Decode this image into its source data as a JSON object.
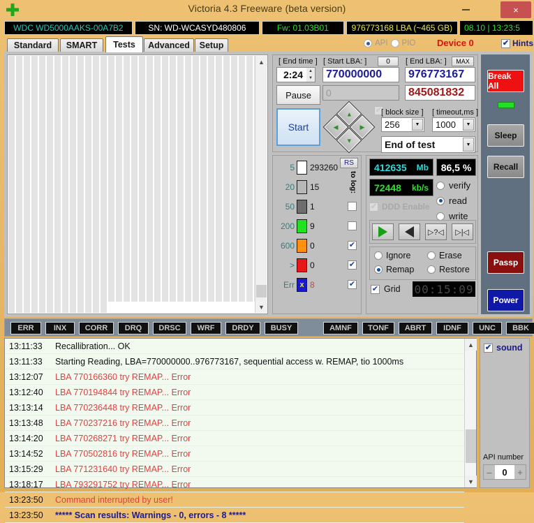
{
  "window": {
    "title": "Victoria 4.3 Freeware (beta version)",
    "icon": "green-cross-icon",
    "minimize": "–",
    "maximize": "□",
    "close": "×"
  },
  "drive_info": {
    "model": "WDC WD5000AAKS-00A7B2",
    "serial": "SN: WD-WCASYD480806",
    "firmware": "Fw: 01.03B01",
    "capacity": "976773168 LBA (~465 GB)",
    "clock": "08.10  |  13:23:5"
  },
  "tabs": [
    {
      "label": "Standard",
      "active": false
    },
    {
      "label": "SMART",
      "active": false
    },
    {
      "label": "Tests",
      "active": true
    },
    {
      "label": "Advanced",
      "active": false
    },
    {
      "label": "Setup",
      "active": false
    }
  ],
  "interface": {
    "api_label": "API",
    "pio_label": "PIO",
    "api_selected": true,
    "device_label": "Device 0",
    "hints_label": "Hints",
    "hints_checked": true
  },
  "params": {
    "end_time_label": "[ End time ]",
    "end_time_value": "2:24",
    "start_lba_label": "[ Start LBA: ]",
    "start_lba_zero_button": "0",
    "start_lba_value": "770000000",
    "end_lba_label": "[ End LBA: ]",
    "end_lba_max_button": "MAX",
    "end_lba_value": "976773167",
    "progress_value": "0",
    "current_lba_value": "845081832",
    "pause_button": "Pause",
    "start_button": "Start",
    "block_size_label": "[ block size ]",
    "block_size_value": "256",
    "timeout_label": "[ timeout,ms ]",
    "timeout_value": "1000",
    "end_of_test_value": "End of test"
  },
  "histogram": {
    "rs_button": "RS",
    "to_log_label": "to log:",
    "rows": [
      {
        "threshold": "5",
        "color": "#ffffff",
        "count": "293260",
        "logged": null
      },
      {
        "threshold": "20",
        "color": "#b8b8b8",
        "count": "15",
        "logged": null
      },
      {
        "threshold": "50",
        "color": "#6e6e6e",
        "count": "1",
        "logged": false
      },
      {
        "threshold": "200",
        "color": "#22e022",
        "count": "9",
        "logged": false
      },
      {
        "threshold": "600",
        "color": "#ff9010",
        "count": "0",
        "logged": true
      },
      {
        "threshold": ">",
        "color": "#e81818",
        "count": "0",
        "logged": true
      },
      {
        "threshold": "Err",
        "color": "#1a1acc",
        "count": "8",
        "logged": true
      }
    ]
  },
  "stats": {
    "mb_value": "412635",
    "mb_unit": "Mb",
    "percent": "86,5 %",
    "speed_value": "72448",
    "speed_unit": "kb/s",
    "ddd_label": "DDD Enable",
    "ddd_checked": false,
    "modes": [
      {
        "label": "verify",
        "selected": false
      },
      {
        "label": "read",
        "selected": true
      },
      {
        "label": "write",
        "selected": false
      }
    ],
    "transport": [
      {
        "icon": "play-forward-icon",
        "glyph": ""
      },
      {
        "icon": "play-backward-icon",
        "glyph": ""
      },
      {
        "icon": "random-seek-icon",
        "glyph": "▷?◁"
      },
      {
        "icon": "butterfly-seek-icon",
        "glyph": "▷|◁"
      }
    ],
    "actions": [
      {
        "label": "Ignore",
        "selected": false
      },
      {
        "label": "Remap",
        "selected": true
      },
      {
        "label": "Erase",
        "selected": false
      },
      {
        "label": "Restore",
        "selected": false
      }
    ],
    "grid_label": "Grid",
    "grid_checked": true,
    "timer": "00:15:09"
  },
  "right_buttons": [
    {
      "label": "Break All",
      "color": "#ef1111"
    },
    {
      "label": "Sleep",
      "color": "#9a9a9a"
    },
    {
      "label": "Recall",
      "color": "#9a9a9a"
    },
    {
      "label": "Passp",
      "color": "#8a1010"
    },
    {
      "label": "Power",
      "color": "#1018a8"
    }
  ],
  "status_flags_left": [
    "ERR",
    "INX",
    "CORR",
    "DRQ",
    "DRSC",
    "WRF",
    "DRDY",
    "BUSY"
  ],
  "status_flags_right": [
    "AMNF",
    "TONF",
    "ABRT",
    "IDNF",
    "UNC",
    "BBK"
  ],
  "log": [
    {
      "time": "13:11:33",
      "message": "Recallibration... OK",
      "type": "info"
    },
    {
      "time": "13:11:33",
      "message": "Starting Reading, LBA=770000000..976773167, sequential access w. REMAP, tio 1000ms",
      "type": "info"
    },
    {
      "time": "13:12:07",
      "message": "LBA 770166360 try REMAP... Error",
      "type": "error"
    },
    {
      "time": "13:12:40",
      "message": "LBA 770194844 try REMAP... Error",
      "type": "error"
    },
    {
      "time": "13:13:14",
      "message": "LBA 770236448 try REMAP... Error",
      "type": "error"
    },
    {
      "time": "13:13:48",
      "message": "LBA 770237216 try REMAP... Error",
      "type": "error"
    },
    {
      "time": "13:14:20",
      "message": "LBA 770268271 try REMAP... Error",
      "type": "error"
    },
    {
      "time": "13:14:52",
      "message": "LBA 770502816 try REMAP... Error",
      "type": "error"
    },
    {
      "time": "13:15:29",
      "message": "LBA 771231640 try REMAP... Error",
      "type": "error"
    },
    {
      "time": "13:18:17",
      "message": "LBA 793291752 try REMAP... Error",
      "type": "error"
    },
    {
      "time": "13:23:50",
      "message": "Command interrupted by user!",
      "type": "error"
    },
    {
      "time": "13:23:50",
      "message": "***** Scan results: Warnings - 0, errors - 8 *****",
      "type": "summary"
    }
  ],
  "bottom_right": {
    "sound_label": "sound",
    "sound_checked": true,
    "api_number_label": "API number",
    "api_number_value": "0",
    "minus": "–",
    "plus": "+"
  }
}
